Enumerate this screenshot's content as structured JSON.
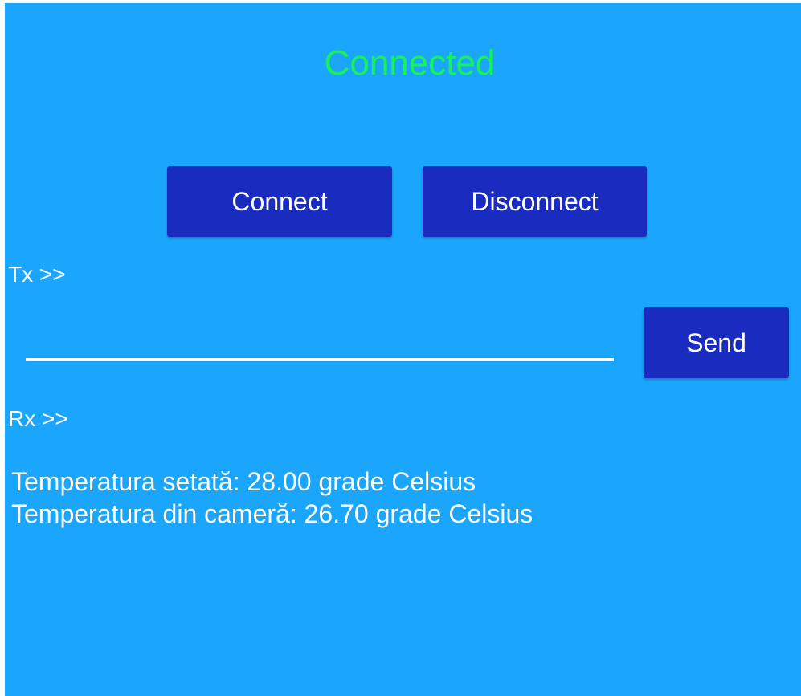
{
  "status": {
    "text": "Connected",
    "color": "#18f25a"
  },
  "buttons": {
    "connect_label": "Connect",
    "disconnect_label": "Disconnect",
    "send_label": "Send"
  },
  "tx": {
    "label": "Tx >>",
    "input_value": ""
  },
  "rx": {
    "label": "Rx >>",
    "lines": [
      "Temperatura setată: 28.00 grade Celsius",
      "Temperatura din cameră: 26.70 grade Celsius"
    ]
  },
  "colors": {
    "background": "#1ba6fd",
    "button": "#1a2bc0",
    "text": "#ffffff"
  }
}
